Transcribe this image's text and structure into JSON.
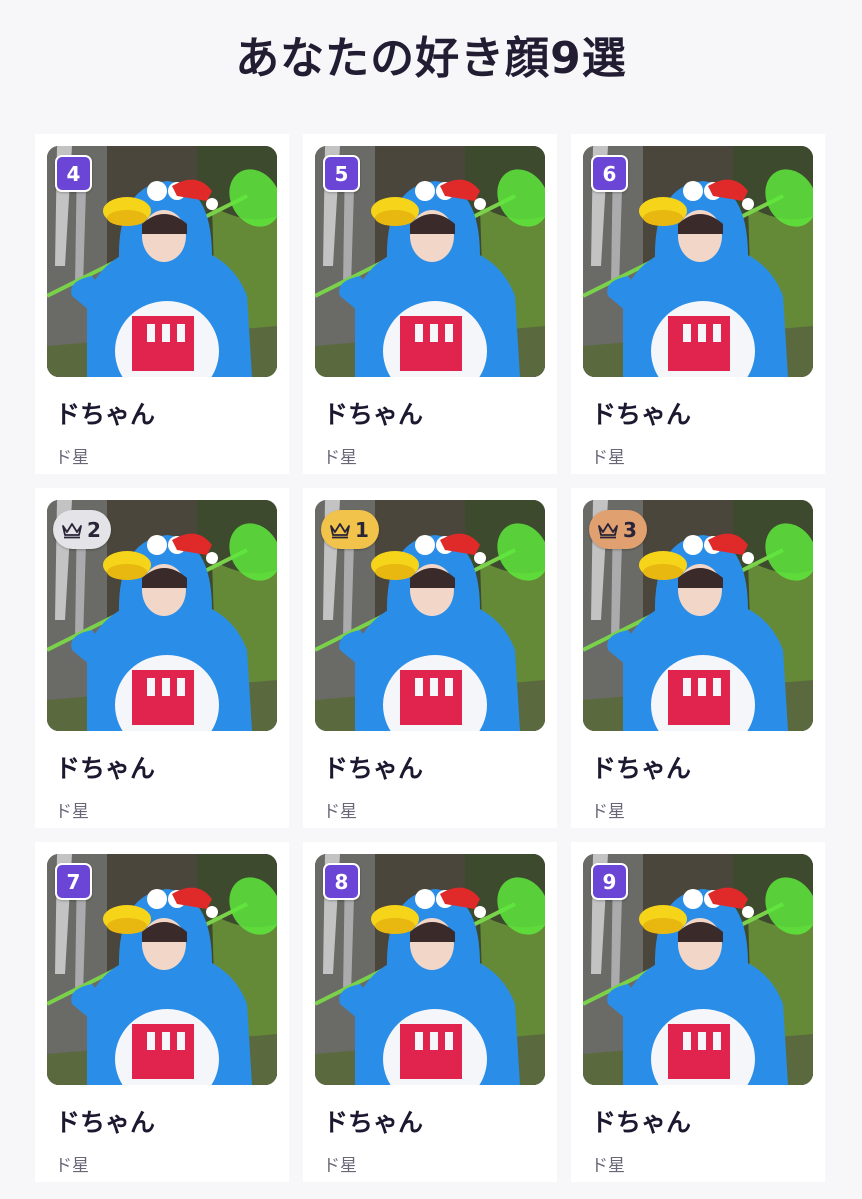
{
  "title": "あなたの好き顔9選",
  "colors": {
    "accent_purple": "#6b45d6",
    "silver": "#e3e3e8",
    "gold": "#f2c34a",
    "bronze": "#e0a070"
  },
  "cards": [
    {
      "rank": "4",
      "badge_type": "number",
      "name": "ドちゃん",
      "group": "ド星"
    },
    {
      "rank": "5",
      "badge_type": "number",
      "name": "ドちゃん",
      "group": "ド星"
    },
    {
      "rank": "6",
      "badge_type": "number",
      "name": "ドちゃん",
      "group": "ド星"
    },
    {
      "rank": "2",
      "badge_type": "crown-silver",
      "icon": "crown-icon",
      "name": "ドちゃん",
      "group": "ド星"
    },
    {
      "rank": "1",
      "badge_type": "crown-gold",
      "icon": "crown-icon",
      "name": "ドちゃん",
      "group": "ド星"
    },
    {
      "rank": "3",
      "badge_type": "crown-bronze",
      "icon": "crown-icon",
      "name": "ドちゃん",
      "group": "ド星"
    },
    {
      "rank": "7",
      "badge_type": "number",
      "name": "ドちゃん",
      "group": "ド星"
    },
    {
      "rank": "8",
      "badge_type": "number",
      "name": "ドちゃん",
      "group": "ド星"
    },
    {
      "rank": "9",
      "badge_type": "number",
      "name": "ドちゃん",
      "group": "ド星"
    }
  ]
}
